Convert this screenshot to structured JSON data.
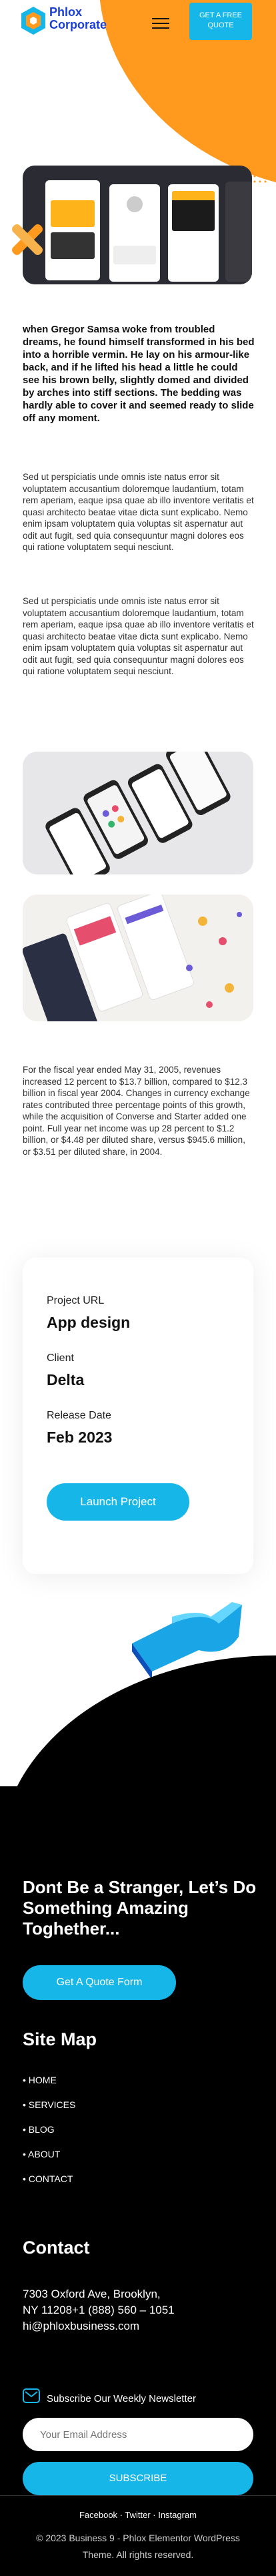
{
  "header": {
    "logo_line1": "Phlox",
    "logo_line2": "Corporate",
    "quote_label_line1": "GET A FREE",
    "quote_label_line2": "QUOTE"
  },
  "intro": {
    "lead": "when Gregor Samsa woke from troubled dreams, he found himself transformed in his bed into a horrible vermin. He lay on his armour-like back, and if he lifted his head a little he could see his brown belly, slightly domed and divided by arches into stiff sections. The bedding was hardly able to cover it and seemed ready to slide off any moment.",
    "para1": "Sed ut perspiciatis unde omnis iste natus error sit voluptatem accusantium doloremque laudantium, totam rem aperiam, eaque ipsa quae ab illo inventore veritatis et quasi architecto beatae vitae dicta sunt explicabo. Nemo enim ipsam voluptatem quia voluptas sit aspernatur aut odit aut fugit, sed quia consequuntur magni dolores eos qui ratione voluptatem sequi nesciunt.",
    "para2": "Sed ut perspiciatis unde omnis iste natus error sit voluptatem accusantium doloremque laudantium, totam rem aperiam, eaque ipsa quae ab illo inventore veritatis et quasi architecto beatae vitae dicta sunt explicabo. Nemo enim ipsam voluptatem quia voluptas sit aspernatur aut odit aut fugit, sed quia consequuntur magni dolores eos qui ratione voluptatem sequi nesciunt.",
    "para3": "For the fiscal year ended May 31, 2005, revenues increased 12 percent to $13.7 billion, compared to $12.3 billion in fiscal year 2004. Changes in currency exchange rates contributed three percentage points of this growth, while the acquisition of Converse and Starter added one point. Full year net income was up 28 percent to $1.2 billion, or $4.48 per diluted share, versus $945.6 million, or $3.51 per diluted share, in 2004."
  },
  "project": {
    "url_label": "Project URL",
    "url_value": "App design",
    "client_label": "Client",
    "client_value": "Delta",
    "date_label": "Release Date",
    "date_value": "Feb 2023",
    "launch_label": "Launch Project"
  },
  "footer": {
    "cta_title": "Dont Be a Stranger, Let’s Do Something Amazing Toghether...",
    "cta_button": "Get A Quote Form",
    "sitemap_title": "Site Map",
    "sitemap_items": [
      "HOME",
      "SERVICES",
      "BLOG",
      "ABOUT",
      "CONTACT"
    ],
    "contact_title": "Contact",
    "contact_line1": "7303 Oxford Ave, Brooklyn,",
    "contact_line2": "NY 11208+1 (888) 560 – 1051",
    "contact_line3": "hi@phloxbusiness.com",
    "newsletter_label": "Subscribe Our Weekly Newsletter",
    "email_placeholder": "Your Email Address",
    "subscribe_label": "SUBSCRIBE",
    "social": "Facebook  ·  Twitter  ·  Instagram",
    "copyright_line1": "© 2023 Business 9 - Phlox Elementor WordPress",
    "copyright_line2": "Theme. All rights reserved."
  },
  "colors": {
    "accent": "#16b7e8",
    "orange": "#ff9a1f",
    "brand_blue": "#1a3fd8"
  }
}
